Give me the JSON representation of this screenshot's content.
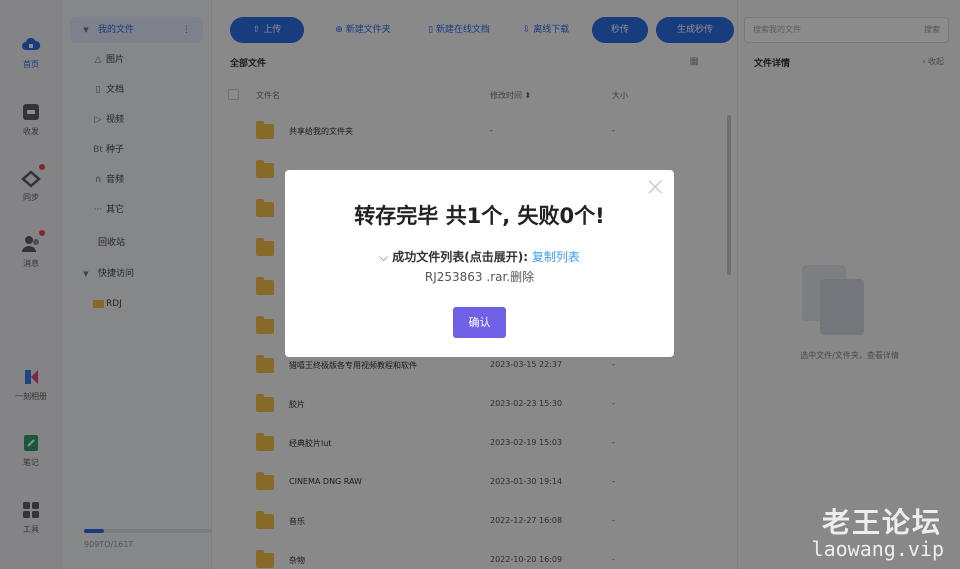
{
  "rail": {
    "items": [
      {
        "label": "首页",
        "icon": "cloud-icon",
        "color": "#2b6fe8"
      },
      {
        "label": "收发",
        "icon": "inbox-icon",
        "color": "#5b5f6b"
      },
      {
        "label": "同步",
        "icon": "sync-icon",
        "color": "#5b5f6b"
      },
      {
        "label": "消息",
        "icon": "user-icon",
        "color": "#5b5f6b"
      },
      {
        "label": "一刻相册",
        "icon": "album-icon",
        "color": "#3b7bf0"
      },
      {
        "label": "笔记",
        "icon": "note-icon",
        "color": "#2fa36b"
      },
      {
        "label": "工具",
        "icon": "grid-icon",
        "color": "#5b5f6b"
      }
    ]
  },
  "tree": {
    "my_files": "我的文件",
    "items": [
      {
        "label": "图片",
        "icon": "△"
      },
      {
        "label": "文档",
        "icon": "▯"
      },
      {
        "label": "视频",
        "icon": "▷"
      },
      {
        "label": "种子",
        "icon": "Bt"
      },
      {
        "label": "音频",
        "icon": "∩"
      },
      {
        "label": "其它",
        "icon": "···"
      }
    ],
    "recycle": "回收站",
    "quick_access": "快捷访问",
    "quick_items": [
      {
        "label": "RDJ"
      }
    ],
    "storage_text": "909TO/161T",
    "storage_fraction": 0.12
  },
  "toolbar": {
    "upload": "上传",
    "new_folder": "新建文件夹",
    "new_online_doc": "新建在线文档",
    "offline_download": "离线下载",
    "instant_transfer": "秒传",
    "gen_instant_transfer": "生成秒传"
  },
  "main": {
    "breadcrumb": "全部文件",
    "columns": {
      "name": "文件名",
      "modified": "修改时间",
      "size": "大小"
    },
    "rows": [
      {
        "name": "共享给我的文件夹",
        "date": "-",
        "size": "-"
      },
      {
        "name": "",
        "date": "",
        "size": ""
      },
      {
        "name": "",
        "date": "",
        "size": ""
      },
      {
        "name": "",
        "date": "",
        "size": ""
      },
      {
        "name": "",
        "date": "",
        "size": ""
      },
      {
        "name": "",
        "date": "",
        "size": ""
      },
      {
        "name": "猎嘻王终极版各专用视频教程和软件",
        "date": "2023-03-15 22:37",
        "size": "-"
      },
      {
        "name": "胶片",
        "date": "2023-02-23 15:30",
        "size": "-"
      },
      {
        "name": "经典胶片lut",
        "date": "2023-02-19 15:03",
        "size": "-"
      },
      {
        "name": "CINEMA DNG RAW",
        "date": "2023-01-30 19:14",
        "size": "-"
      },
      {
        "name": "音乐",
        "date": "2022-12-27 16:08",
        "size": "-"
      },
      {
        "name": "杂物",
        "date": "2022-10-20 16:09",
        "size": "-"
      }
    ]
  },
  "right": {
    "search_placeholder": "搜索我的文件",
    "search_btn": "搜索",
    "title": "文件详情",
    "collapse": "收起",
    "empty_hint": "选中文件/文件夹，查看详情"
  },
  "modal": {
    "title": "转存完毕 共1个, 失败0个!",
    "list_label": "成功文件列表(点击展开):",
    "copy_link": "复制列表",
    "file": "RJ253863 .rar.删除",
    "ok": "确认",
    "close": "×"
  },
  "watermark": {
    "line1": "老王论坛",
    "line2": "laowang.vip"
  }
}
